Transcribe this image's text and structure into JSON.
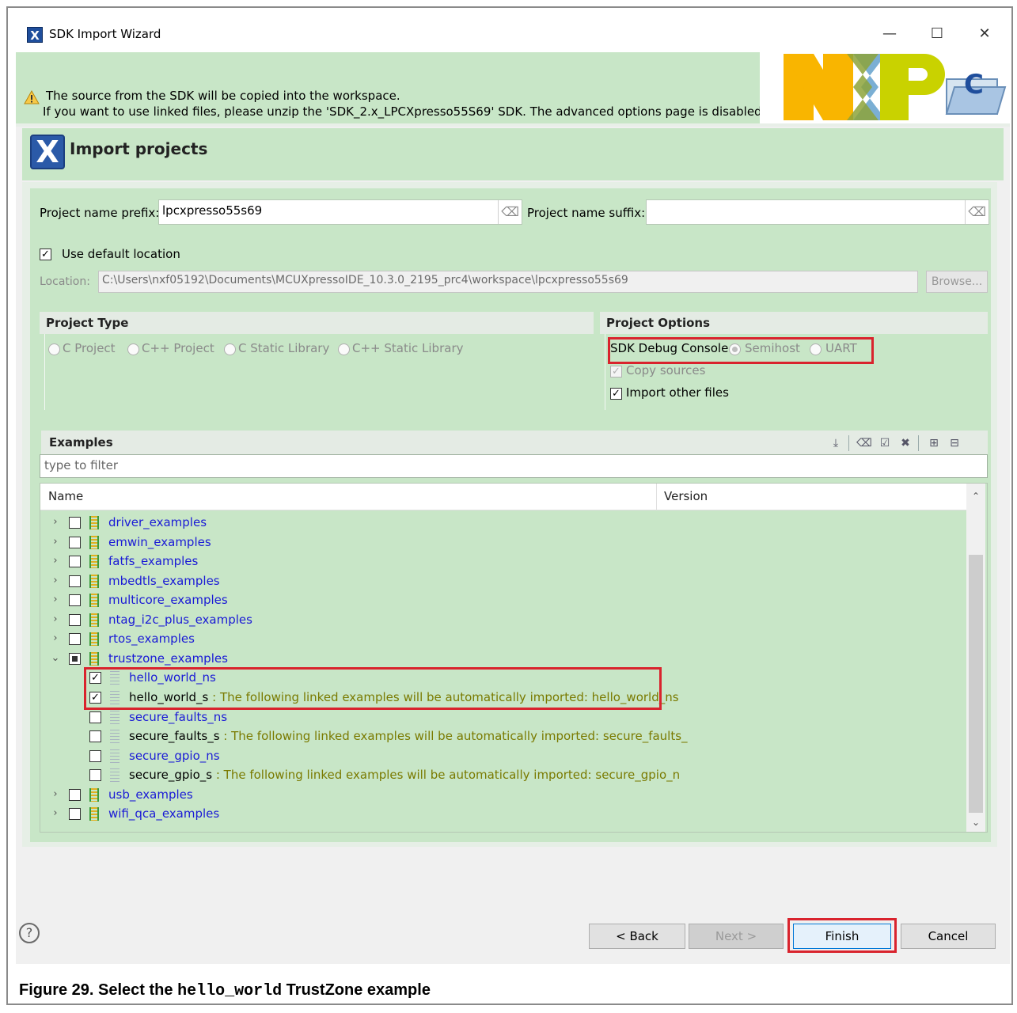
{
  "window": {
    "title": "SDK Import Wizard",
    "minimize": "—",
    "maximize": "☐",
    "close": "✕"
  },
  "banner": {
    "line1": "The source from the SDK will be copied into the workspace.",
    "line2": "If you want to use linked files, please unzip the 'SDK_2.x_LPCXpresso55S69' SDK. The advanced options page is disabled when",
    "logo_text": "NXP"
  },
  "header": {
    "title": "Import projects"
  },
  "form": {
    "prefix_label": "Project name prefix:",
    "prefix_value": "lpcxpresso55s69",
    "suffix_label": "Project name suffix:",
    "suffix_value": "",
    "use_default_label": "Use default location",
    "use_default_checked": "☑",
    "location_label": "Location:",
    "location_value": "C:\\Users\\nxf05192\\Documents\\MCUXpressoIDE_10.3.0_2195_prc4\\workspace\\lpcxpresso55s69",
    "browse_label": "Browse..."
  },
  "project_type": {
    "title": "Project Type",
    "options": [
      "C Project",
      "C++ Project",
      "C Static Library",
      "C++ Static Library"
    ]
  },
  "project_options": {
    "title": "Project Options",
    "console_label": "SDK Debug Console",
    "semihost_label": "Semihost",
    "uart_label": "UART",
    "copy_sources_label": "Copy sources",
    "import_other_label": "Import other files",
    "check_mark": "✓"
  },
  "examples": {
    "title": "Examples",
    "filter_placeholder": "type to filter",
    "col_name": "Name",
    "col_version": "Version",
    "tree": [
      {
        "name": "driver_examples",
        "note": "",
        "level": 0,
        "checked": "",
        "twist": "›"
      },
      {
        "name": "emwin_examples",
        "note": "",
        "level": 0,
        "checked": "",
        "twist": "›"
      },
      {
        "name": "fatfs_examples",
        "note": "",
        "level": 0,
        "checked": "",
        "twist": "›"
      },
      {
        "name": "mbedtls_examples",
        "note": "",
        "level": 0,
        "checked": "",
        "twist": "›"
      },
      {
        "name": "multicore_examples",
        "note": "",
        "level": 0,
        "checked": "",
        "twist": "›"
      },
      {
        "name": "ntag_i2c_plus_examples",
        "note": "",
        "level": 0,
        "checked": "",
        "twist": "›"
      },
      {
        "name": "rtos_examples",
        "note": "",
        "level": 0,
        "checked": "",
        "twist": "›"
      },
      {
        "name": "trustzone_examples",
        "note": "",
        "level": 0,
        "checked": "partial",
        "twist": "⌄"
      },
      {
        "name": "hello_world_ns",
        "note": "",
        "level": 1,
        "checked": "✓",
        "twist": ""
      },
      {
        "name": "hello_world_s",
        "note": " : The following linked examples will be automatically imported: hello_world_ns",
        "level": 1,
        "checked": "✓",
        "twist": ""
      },
      {
        "name": "secure_faults_ns",
        "note": "",
        "level": 1,
        "checked": "",
        "twist": ""
      },
      {
        "name": "secure_faults_s",
        "note": " : The following linked examples will be automatically imported: secure_faults_",
        "level": 1,
        "checked": "",
        "twist": ""
      },
      {
        "name": "secure_gpio_ns",
        "note": "",
        "level": 1,
        "checked": "",
        "twist": ""
      },
      {
        "name": "secure_gpio_s",
        "note": " : The following linked examples will be automatically imported: secure_gpio_n",
        "level": 1,
        "checked": "",
        "twist": ""
      },
      {
        "name": "usb_examples",
        "note": "",
        "level": 0,
        "checked": "",
        "twist": "›"
      },
      {
        "name": "wifi_qca_examples",
        "note": "",
        "level": 0,
        "checked": "",
        "twist": "›"
      }
    ]
  },
  "buttons": {
    "help": "?",
    "back": "< Back",
    "next": "Next >",
    "finish": "Finish",
    "cancel": "Cancel"
  },
  "caption": {
    "prefix": "Figure 29.  Select the ",
    "code": "hello_world",
    "suffix": " TrustZone example"
  },
  "colors": {
    "accent_green": "#c8e6c7",
    "highlight_red": "#d9232d",
    "link_blue": "#1a1ad6",
    "note_olive": "#7a7a00"
  }
}
